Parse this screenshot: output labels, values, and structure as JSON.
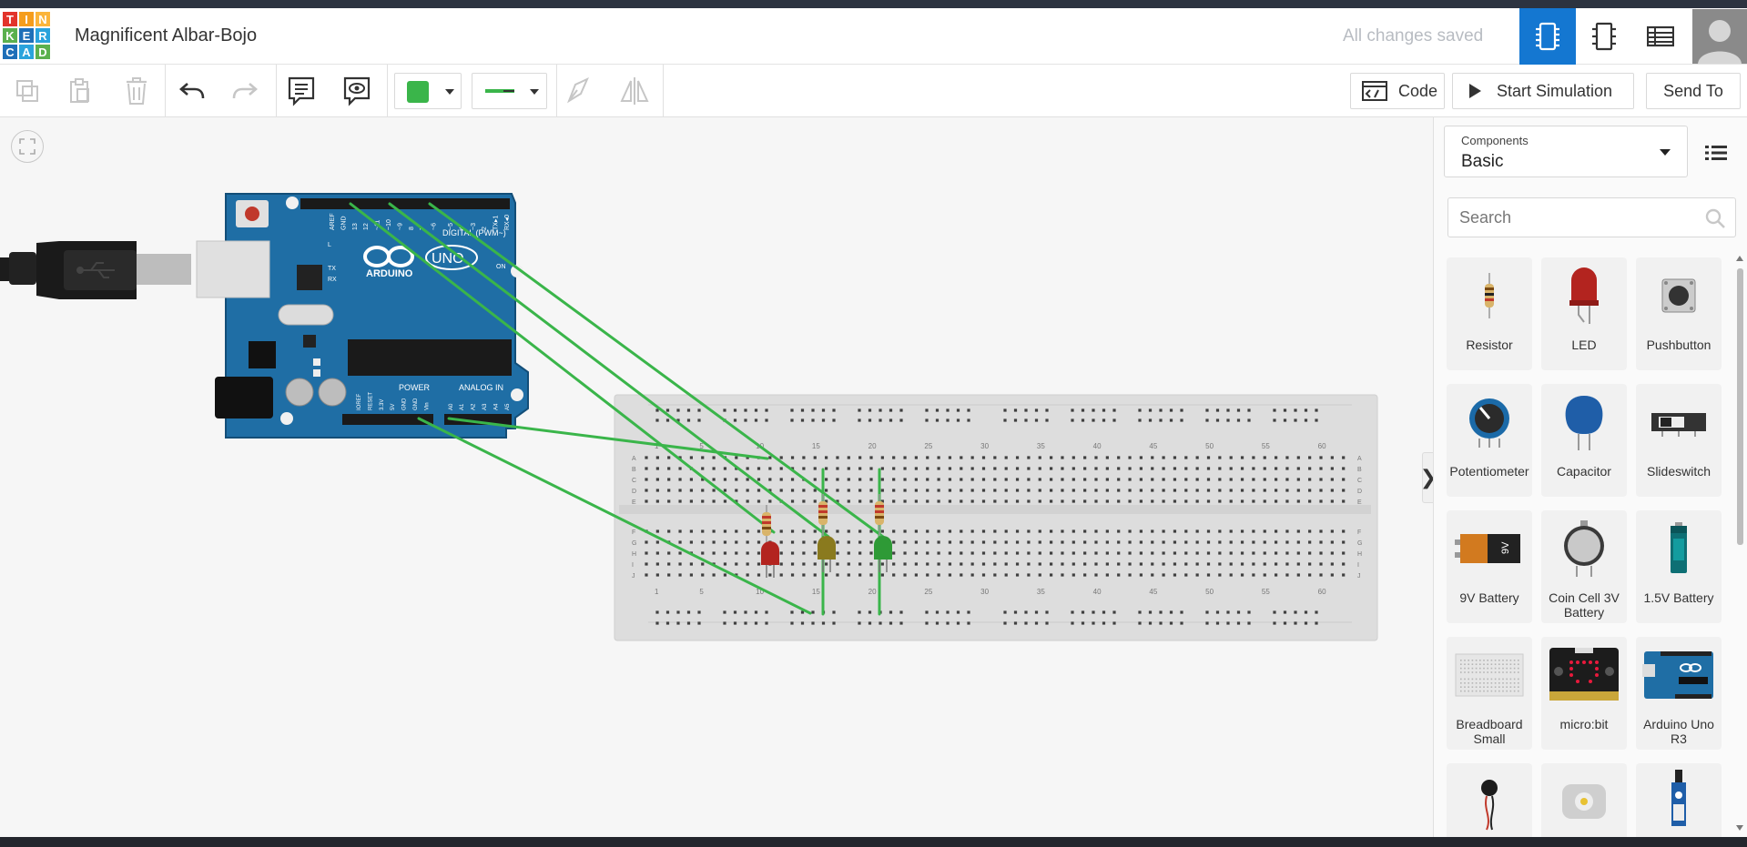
{
  "app": {
    "logo_letters": [
      "T",
      "I",
      "N",
      "K",
      "E",
      "R",
      "C",
      "A",
      "D"
    ],
    "logo_colors": [
      "#e2342b",
      "#f59d1c",
      "#fbb53b",
      "#5bb04e",
      "#1e6fb8",
      "#2aa3dc",
      "#1e6fb8",
      "#2aa3dc",
      "#5bb04e"
    ],
    "project_title": "Magnificent Albar-Bojo",
    "save_status": "All changes saved",
    "accent": "#1477d1"
  },
  "header": {
    "views": [
      {
        "name": "circuit-view-icon",
        "active": true
      },
      {
        "name": "schematic-view-icon",
        "active": false
      },
      {
        "name": "component-list-icon",
        "active": false
      }
    ]
  },
  "toolbar": {
    "tools": [
      "copy-icon",
      "paste-icon",
      "delete-icon",
      "undo-icon",
      "redo-icon",
      "notes-icon",
      "visibility-icon"
    ],
    "wire_color": "#3ab54a",
    "code_label": "Code",
    "start_sim_label": "Start Simulation",
    "send_to_label": "Send To"
  },
  "panel": {
    "components_label": "Components",
    "components_value": "Basic",
    "search_placeholder": "Search",
    "components": [
      {
        "label": "Resistor"
      },
      {
        "label": "LED"
      },
      {
        "label": "Pushbutton"
      },
      {
        "label": "Potentiometer"
      },
      {
        "label": "Capacitor"
      },
      {
        "label": "Slideswitch"
      },
      {
        "label": "9V Battery"
      },
      {
        "label": "Coin Cell 3V Battery"
      },
      {
        "label": "1.5V Battery"
      },
      {
        "label": "Breadboard Small"
      },
      {
        "label": "micro:bit"
      },
      {
        "label": "Arduino Uno R3"
      },
      {
        "label": ""
      },
      {
        "label": ""
      },
      {
        "label": ""
      }
    ]
  },
  "arduino": {
    "brand": "ARDUINO",
    "model": "UNO",
    "digital_label": "DIGITAL (PWM~)",
    "power_label": "POWER",
    "analog_label": "ANALOG IN",
    "on_label": "ON",
    "tx_label": "TX",
    "rx_label": "RX",
    "l_label": "L",
    "top_pins": [
      "AREF",
      "GND",
      "13",
      "12",
      "~11",
      "~10",
      "~9",
      "8",
      "7",
      "~6",
      "~5",
      "4",
      "~3",
      "2",
      "TX▸1",
      "RX◂0"
    ],
    "bottom_pins": [
      "IOREF",
      "RESET",
      "3.3V",
      "5V",
      "GND",
      "GND",
      "Vin",
      "A0",
      "A1",
      "A2",
      "A3",
      "A4",
      "A5"
    ]
  },
  "breadboard": {
    "column_numbers": [
      "1",
      "5",
      "10",
      "15",
      "20",
      "25",
      "30",
      "35",
      "40",
      "45",
      "50",
      "55",
      "60"
    ],
    "row_letters_top": [
      "A",
      "B",
      "C",
      "D",
      "E"
    ],
    "row_letters_bottom": [
      "F",
      "G",
      "H",
      "I",
      "J"
    ]
  },
  "circuit": {
    "leds": [
      {
        "color": "#b3241f"
      },
      {
        "color": "#8a7a1e"
      },
      {
        "color": "#2e9a36"
      }
    ]
  }
}
